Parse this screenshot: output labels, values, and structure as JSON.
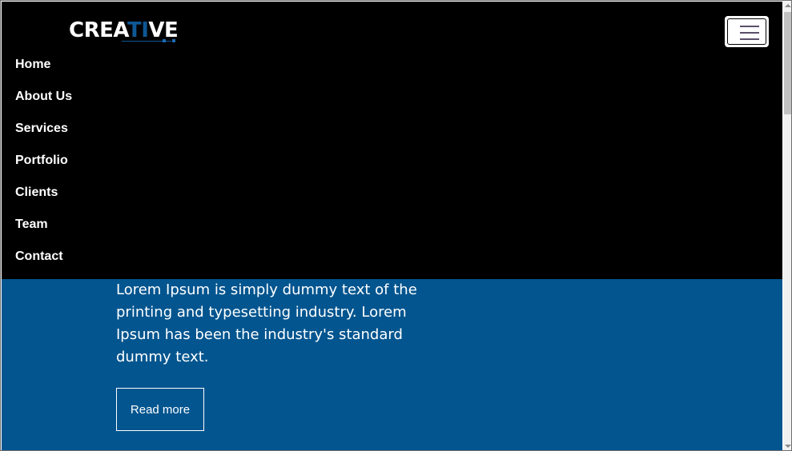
{
  "brand": {
    "logo_prefix": "CREA",
    "logo_accent": "TI",
    "logo_suffix": "VE",
    "accent_color": "#0f5795"
  },
  "navbar": {
    "toggler_icon": "hamburger-menu-icon",
    "background": "#000000",
    "items": [
      {
        "label": "Home"
      },
      {
        "label": "About Us"
      },
      {
        "label": "Services"
      },
      {
        "label": "Portfolio"
      },
      {
        "label": "Clients"
      },
      {
        "label": "Team"
      },
      {
        "label": "Contact"
      }
    ]
  },
  "hero": {
    "background": "#02558f",
    "text": "Lorem Ipsum is simply dummy text of the printing and typesetting industry. Lorem Ipsum has been the industry's standard dummy text.",
    "button_label": "Read more"
  }
}
